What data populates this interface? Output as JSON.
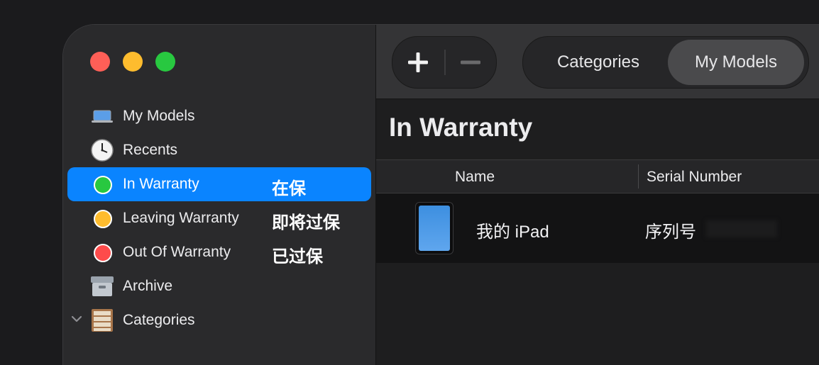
{
  "sidebar": {
    "items": [
      {
        "label": "My Models",
        "icon": "laptop-icon"
      },
      {
        "label": "Recents",
        "icon": "clock-icon"
      },
      {
        "label": "In Warranty",
        "icon": "green-dot-icon",
        "annotation": "在保",
        "selected": true
      },
      {
        "label": "Leaving Warranty",
        "icon": "orange-dot-icon",
        "annotation": "即将过保"
      },
      {
        "label": "Out Of Warranty",
        "icon": "red-dot-icon",
        "annotation": "已过保"
      },
      {
        "label": "Archive",
        "icon": "archive-box-icon"
      },
      {
        "label": "Categories",
        "icon": "drawer-cabinet-icon",
        "expanded": false
      }
    ]
  },
  "toolbar": {
    "segments": [
      "Categories",
      "My Models"
    ],
    "selected_segment": "My Models"
  },
  "main": {
    "title": "In Warranty",
    "columns": [
      "Name",
      "Serial Number"
    ],
    "rows": [
      {
        "name": "我的 iPad",
        "serial": "序列号"
      }
    ]
  },
  "colors": {
    "accent": "#0a84ff",
    "in_warranty": "#28c840",
    "leaving_warranty": "#febc2e",
    "out_of_warranty": "#fe4b4b"
  }
}
